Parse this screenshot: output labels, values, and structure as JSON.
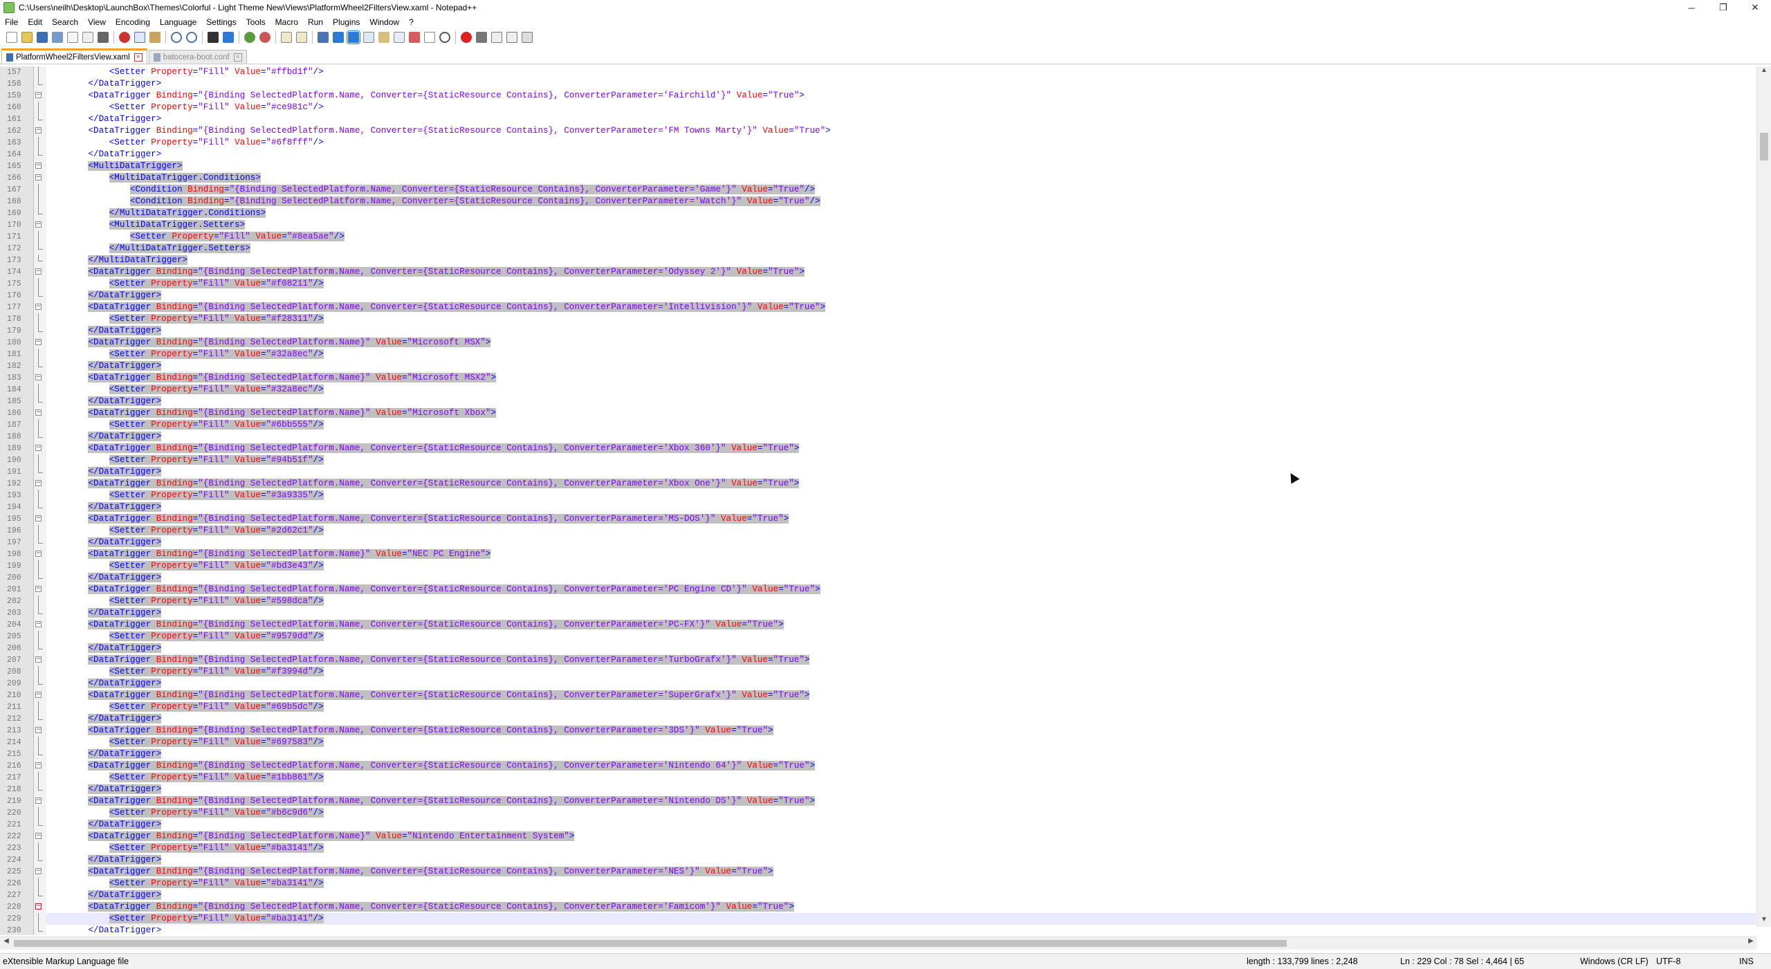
{
  "window": {
    "title": "C:\\Users\\neilh\\Desktop\\LaunchBox\\Themes\\Colorful - Light Theme New\\Views\\PlatformWheel2FiltersView.xaml - Notepad++",
    "minimize": "─",
    "restore": "❐",
    "close": "✕"
  },
  "menu": [
    "File",
    "Edit",
    "Search",
    "View",
    "Encoding",
    "Language",
    "Settings",
    "Tools",
    "Macro",
    "Run",
    "Plugins",
    "Window",
    "?"
  ],
  "tabs": [
    {
      "label": "PlatformWheel2FiltersView.xaml",
      "active": true
    },
    {
      "label": "batocera-boot.conf",
      "active": false
    }
  ],
  "editor": {
    "lines": [
      {
        "n": "157",
        "t": "            <Setter Property=\"Fill\" Value=\"#ffbd1f\"/>"
      },
      {
        "n": "158",
        "t": "        </DataTrigger>"
      },
      {
        "n": "159",
        "t": "        <DataTrigger Binding=\"{Binding SelectedPlatform.Name, Converter={StaticResource Contains}, ConverterParameter='Fairchild'}\" Value=\"True\">"
      },
      {
        "n": "160",
        "t": "            <Setter Property=\"Fill\" Value=\"#ce981c\"/>"
      },
      {
        "n": "161",
        "t": "        </DataTrigger>"
      },
      {
        "n": "162",
        "t": "        <DataTrigger Binding=\"{Binding SelectedPlatform.Name, Converter={StaticResource Contains}, ConverterParameter='FM Towns Marty'}\" Value=\"True\">"
      },
      {
        "n": "163",
        "t": "            <Setter Property=\"Fill\" Value=\"#6f8fff\"/>"
      },
      {
        "n": "164",
        "t": "        </DataTrigger>"
      },
      {
        "n": "165",
        "t": "        <MultiDataTrigger>"
      },
      {
        "n": "166",
        "t": "            <MultiDataTrigger.Conditions>"
      },
      {
        "n": "167",
        "t": "                <Condition Binding=\"{Binding SelectedPlatform.Name, Converter={StaticResource Contains}, ConverterParameter='Game'}\" Value=\"True\"/>"
      },
      {
        "n": "168",
        "t": "                <Condition Binding=\"{Binding SelectedPlatform.Name, Converter={StaticResource Contains}, ConverterParameter='Watch'}\" Value=\"True\"/>"
      },
      {
        "n": "169",
        "t": "            </MultiDataTrigger.Conditions>"
      },
      {
        "n": "170",
        "t": "            <MultiDataTrigger.Setters>"
      },
      {
        "n": "171",
        "t": "                <Setter Property=\"Fill\" Value=\"#8ea5ae\"/>"
      },
      {
        "n": "172",
        "t": "            </MultiDataTrigger.Setters>"
      },
      {
        "n": "173",
        "t": "        </MultiDataTrigger>"
      },
      {
        "n": "174",
        "t": "        <DataTrigger Binding=\"{Binding SelectedPlatform.Name, Converter={StaticResource Contains}, ConverterParameter='Odyssey 2'}\" Value=\"True\">"
      },
      {
        "n": "175",
        "t": "            <Setter Property=\"Fill\" Value=\"#f08211\"/>"
      },
      {
        "n": "176",
        "t": "        </DataTrigger>"
      },
      {
        "n": "177",
        "t": "        <DataTrigger Binding=\"{Binding SelectedPlatform.Name, Converter={StaticResource Contains}, ConverterParameter='Intellivision'}\" Value=\"True\">"
      },
      {
        "n": "178",
        "t": "            <Setter Property=\"Fill\" Value=\"#f28311\"/>"
      },
      {
        "n": "179",
        "t": "        </DataTrigger>"
      },
      {
        "n": "180",
        "t": "        <DataTrigger Binding=\"{Binding SelectedPlatform.Name}\" Value=\"Microsoft MSX\">"
      },
      {
        "n": "181",
        "t": "            <Setter Property=\"Fill\" Value=\"#32a8ec\"/>"
      },
      {
        "n": "182",
        "t": "        </DataTrigger>"
      },
      {
        "n": "183",
        "t": "        <DataTrigger Binding=\"{Binding SelectedPlatform.Name}\" Value=\"Microsoft MSX2\">"
      },
      {
        "n": "184",
        "t": "            <Setter Property=\"Fill\" Value=\"#32a8ec\"/>"
      },
      {
        "n": "185",
        "t": "        </DataTrigger>"
      },
      {
        "n": "186",
        "t": "        <DataTrigger Binding=\"{Binding SelectedPlatform.Name}\" Value=\"Microsoft Xbox\">"
      },
      {
        "n": "187",
        "t": "            <Setter Property=\"Fill\" Value=\"#6bb555\"/>"
      },
      {
        "n": "188",
        "t": "        </DataTrigger>"
      },
      {
        "n": "189",
        "t": "        <DataTrigger Binding=\"{Binding SelectedPlatform.Name, Converter={StaticResource Contains}, ConverterParameter='Xbox 360'}\" Value=\"True\">"
      },
      {
        "n": "190",
        "t": "            <Setter Property=\"Fill\" Value=\"#94b51f\"/>"
      },
      {
        "n": "191",
        "t": "        </DataTrigger>"
      },
      {
        "n": "192",
        "t": "        <DataTrigger Binding=\"{Binding SelectedPlatform.Name, Converter={StaticResource Contains}, ConverterParameter='Xbox One'}\" Value=\"True\">"
      },
      {
        "n": "193",
        "t": "            <Setter Property=\"Fill\" Value=\"#3a9335\"/>"
      },
      {
        "n": "194",
        "t": "        </DataTrigger>"
      },
      {
        "n": "195",
        "t": "        <DataTrigger Binding=\"{Binding SelectedPlatform.Name, Converter={StaticResource Contains}, ConverterParameter='MS-DOS'}\" Value=\"True\">"
      },
      {
        "n": "196",
        "t": "            <Setter Property=\"Fill\" Value=\"#2d62c1\"/>"
      },
      {
        "n": "197",
        "t": "        </DataTrigger>"
      },
      {
        "n": "198",
        "t": "        <DataTrigger Binding=\"{Binding SelectedPlatform.Name}\" Value=\"NEC PC Engine\">"
      },
      {
        "n": "199",
        "t": "            <Setter Property=\"Fill\" Value=\"#bd3e43\"/>"
      },
      {
        "n": "200",
        "t": "        </DataTrigger>"
      },
      {
        "n": "201",
        "t": "        <DataTrigger Binding=\"{Binding SelectedPlatform.Name, Converter={StaticResource Contains}, ConverterParameter='PC Engine CD'}\" Value=\"True\">"
      },
      {
        "n": "202",
        "t": "            <Setter Property=\"Fill\" Value=\"#598dca\"/>"
      },
      {
        "n": "203",
        "t": "        </DataTrigger>"
      },
      {
        "n": "204",
        "t": "        <DataTrigger Binding=\"{Binding SelectedPlatform.Name, Converter={StaticResource Contains}, ConverterParameter='PC-FX'}\" Value=\"True\">"
      },
      {
        "n": "205",
        "t": "            <Setter Property=\"Fill\" Value=\"#9579dd\"/>"
      },
      {
        "n": "206",
        "t": "        </DataTrigger>"
      },
      {
        "n": "207",
        "t": "        <DataTrigger Binding=\"{Binding SelectedPlatform.Name, Converter={StaticResource Contains}, ConverterParameter='TurboGrafx'}\" Value=\"True\">"
      },
      {
        "n": "208",
        "t": "            <Setter Property=\"Fill\" Value=\"#f3994d\"/>"
      },
      {
        "n": "209",
        "t": "        </DataTrigger>"
      },
      {
        "n": "210",
        "t": "        <DataTrigger Binding=\"{Binding SelectedPlatform.Name, Converter={StaticResource Contains}, ConverterParameter='SuperGrafx'}\" Value=\"True\">"
      },
      {
        "n": "211",
        "t": "            <Setter Property=\"Fill\" Value=\"#69b5dc\"/>"
      },
      {
        "n": "212",
        "t": "        </DataTrigger>"
      },
      {
        "n": "213",
        "t": "        <DataTrigger Binding=\"{Binding SelectedPlatform.Name, Converter={StaticResource Contains}, ConverterParameter='3DS'}\" Value=\"True\">"
      },
      {
        "n": "214",
        "t": "            <Setter Property=\"Fill\" Value=\"#697583\"/>"
      },
      {
        "n": "215",
        "t": "        </DataTrigger>"
      },
      {
        "n": "216",
        "t": "        <DataTrigger Binding=\"{Binding SelectedPlatform.Name, Converter={StaticResource Contains}, ConverterParameter='Nintendo 64'}\" Value=\"True\">"
      },
      {
        "n": "217",
        "t": "            <Setter Property=\"Fill\" Value=\"#1bb861\"/>"
      },
      {
        "n": "218",
        "t": "        </DataTrigger>"
      },
      {
        "n": "219",
        "t": "        <DataTrigger Binding=\"{Binding SelectedPlatform.Name, Converter={StaticResource Contains}, ConverterParameter='Nintendo DS'}\" Value=\"True\">"
      },
      {
        "n": "220",
        "t": "            <Setter Property=\"Fill\" Value=\"#b6c9d6\"/>"
      },
      {
        "n": "221",
        "t": "        </DataTrigger>"
      },
      {
        "n": "222",
        "t": "        <DataTrigger Binding=\"{Binding SelectedPlatform.Name}\" Value=\"Nintendo Entertainment System\">"
      },
      {
        "n": "223",
        "t": "            <Setter Property=\"Fill\" Value=\"#ba3141\"/>"
      },
      {
        "n": "224",
        "t": "        </DataTrigger>"
      },
      {
        "n": "225",
        "t": "        <DataTrigger Binding=\"{Binding SelectedPlatform.Name, Converter={StaticResource Contains}, ConverterParameter='NES'}\" Value=\"True\">"
      },
      {
        "n": "226",
        "t": "            <Setter Property=\"Fill\" Value=\"#ba3141\"/>"
      },
      {
        "n": "227",
        "t": "        </DataTrigger>"
      },
      {
        "n": "228",
        "t": "        <DataTrigger Binding=\"{Binding SelectedPlatform.Name, Converter={StaticResource Contains}, ConverterParameter='Famicom'}\" Value=\"True\">"
      },
      {
        "n": "229",
        "t": "            <Setter Property=\"Fill\" Value=\"#ba3141\"/>"
      },
      {
        "n": "230",
        "t": "        </DataTrigger>"
      }
    ]
  },
  "status": {
    "filetype": "eXtensible Markup Language file",
    "length": "length : 133,799    lines : 2,248",
    "position": "Ln : 229    Col : 78    Sel : 4,464 | 65",
    "eol": "Windows (CR LF)",
    "encoding": "UTF-8",
    "mode": "INS"
  },
  "colors": {
    "tab_accent": "#f7a21a",
    "selection": "#c0c0c0",
    "tag": "#0000ff",
    "attr": "#ff0000",
    "value": "#8000ff"
  }
}
